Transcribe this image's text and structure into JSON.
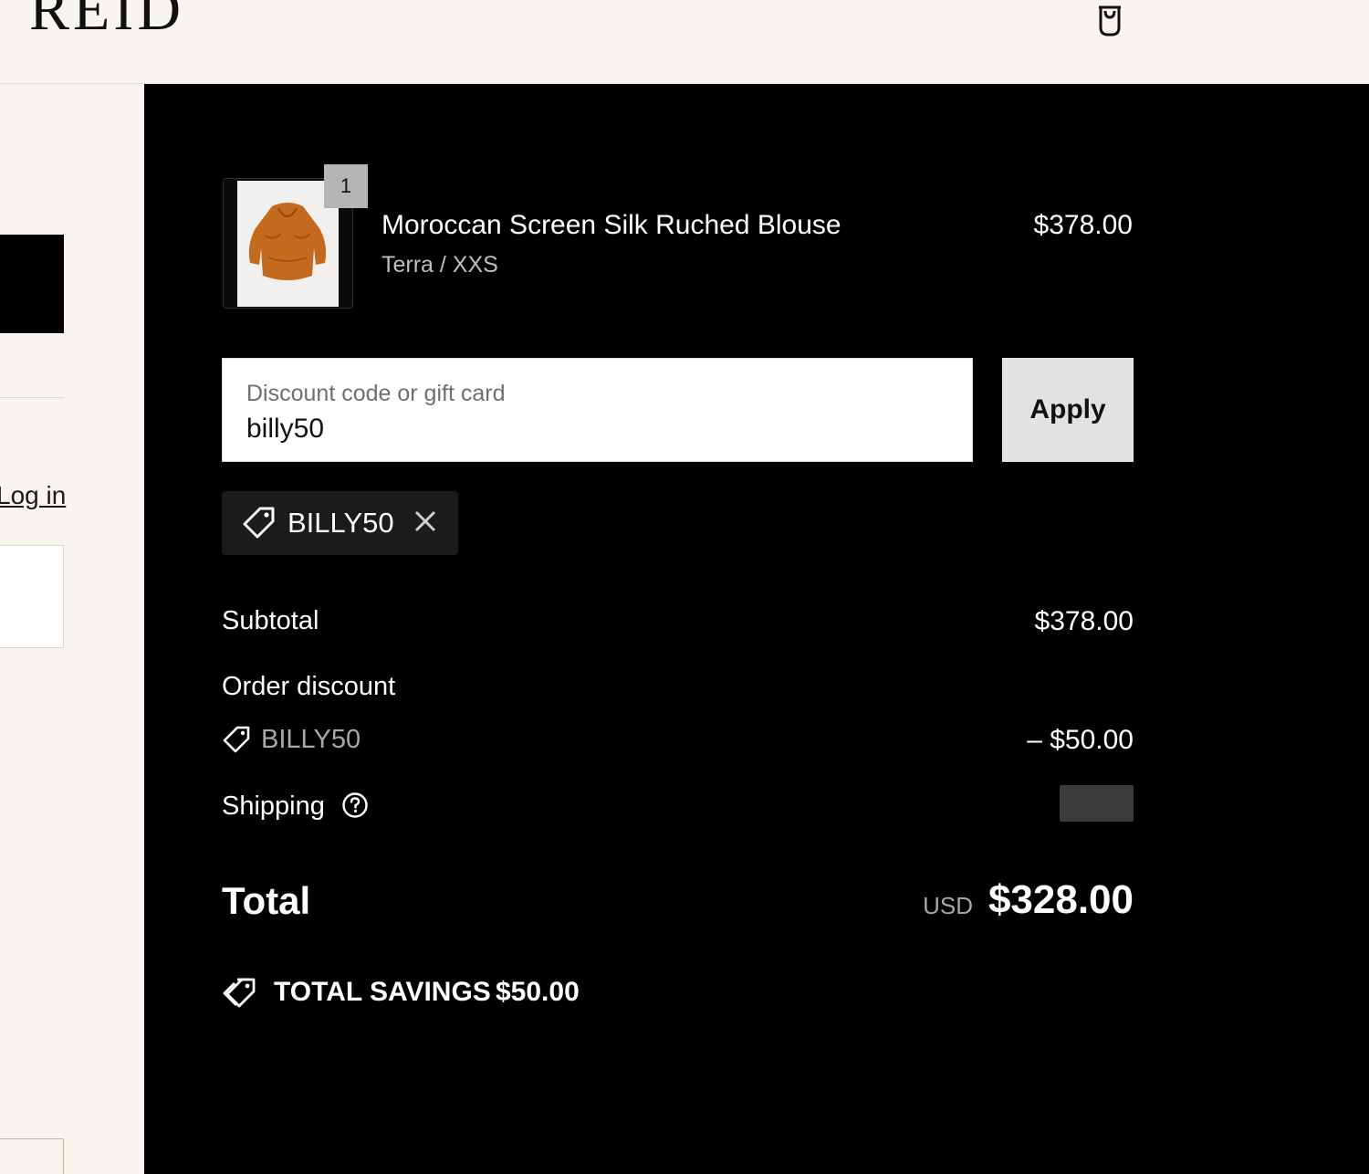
{
  "header": {
    "logo_text": "REID",
    "cart_icon": "shopping-bag-icon"
  },
  "left_panel": {
    "login_link": "Log in"
  },
  "order": {
    "item": {
      "quantity": "1",
      "name": "Moroccan Screen Silk Ruched Blouse",
      "variant": "Terra / XXS",
      "price": "$378.00"
    },
    "discount_input": {
      "label": "Discount code or gift card",
      "value": "billy50"
    },
    "apply_label": "Apply",
    "applied_code": "BILLY50",
    "subtotal_label": "Subtotal",
    "subtotal_value": "$378.00",
    "order_discount_label": "Order discount",
    "order_discount_code": "BILLY50",
    "order_discount_value": "– $50.00",
    "shipping_label": "Shipping",
    "total_label": "Total",
    "total_currency": "USD",
    "total_value": "$328.00",
    "savings_label": "TOTAL SAVINGS",
    "savings_value": "$50.00"
  },
  "colors": {
    "page_background": "#f8f5f0",
    "summary_background": "#000000",
    "chip_background": "#1b1b1b",
    "apply_button": "#e2e2e2",
    "muted_text": "#a8a8a8"
  }
}
